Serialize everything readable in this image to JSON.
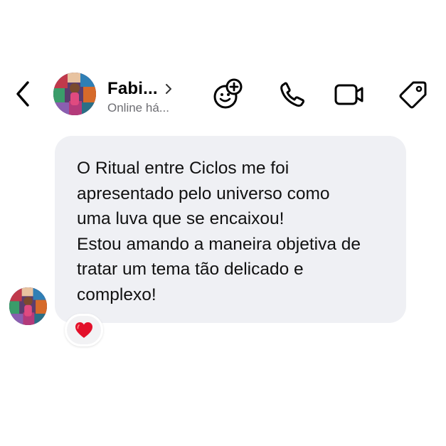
{
  "header": {
    "contact_name": "Fabi...",
    "contact_status": "Online há..."
  },
  "message": {
    "lines": [
      "O Ritual entre Ciclos me foi",
      "apresentado pelo universo como",
      "uma luva que se encaixou!",
      "Estou amando a maneira objetiva de",
      "tratar um tema tão delicado e",
      "complexo!"
    ],
    "reaction": "heart"
  },
  "colors": {
    "bubble_bg": "#eff0f4",
    "status_text": "#6e6e73",
    "reaction_heart": "#e3102a"
  },
  "icons": [
    "back-chevron-icon",
    "chevron-right-icon",
    "add-emoji-icon",
    "phone-icon",
    "video-camera-icon",
    "tag-icon",
    "heart-icon"
  ]
}
